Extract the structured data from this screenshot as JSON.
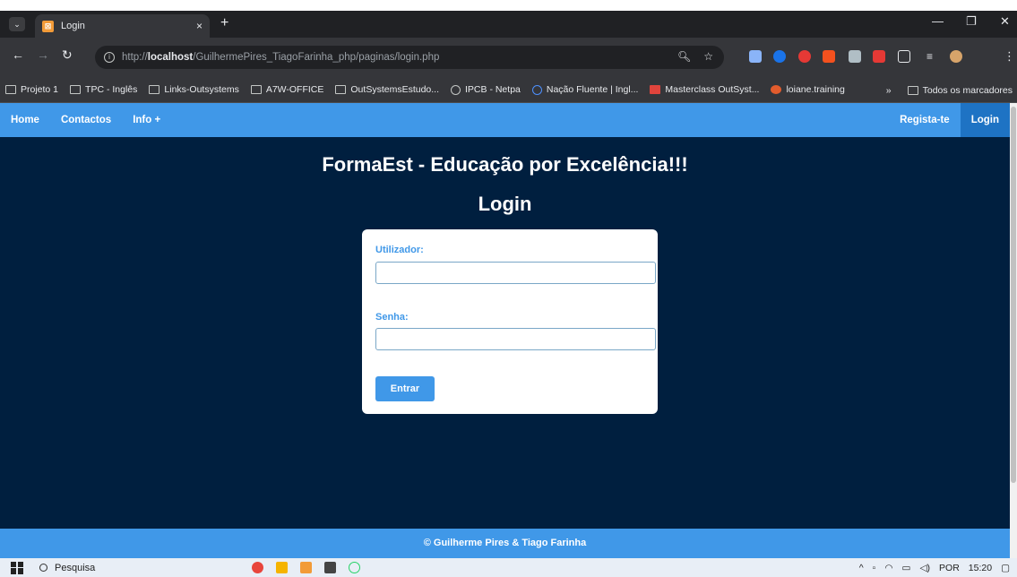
{
  "browser": {
    "tab_title": "Login",
    "tab_close": "×",
    "new_tab": "+",
    "url_prefix": "http://",
    "url_host": "localhost",
    "url_path": "/GuilhermePires_TiagoFarinha_php/paginas/login.php",
    "bookmarks": [
      "Projeto 1",
      "TPC - Inglês",
      "Links-Outsystems",
      "A7W-OFFICE",
      "OutSystemsEstudo...",
      "IPCB - Netpa",
      "Nação Fluente | Ingl...",
      "Masterclass OutSyst...",
      "loiane.training"
    ],
    "bookmarks_more": "»",
    "all_bookmarks": "Todos os marcadores"
  },
  "nav": {
    "home": "Home",
    "contactos": "Contactos",
    "info": "Info +",
    "registar": "Regista-te",
    "login": "Login"
  },
  "page": {
    "heading": "FormaEst - Educação por Excelência!!!",
    "subheading": "Login"
  },
  "form": {
    "user_label": "Utilizador:",
    "user_value": "",
    "password_label": "Senha:",
    "password_value": "",
    "submit": "Entrar"
  },
  "footer": {
    "text": "© Guilherme Pires & Tiago Farinha"
  },
  "taskbar": {
    "search": "Pesquisa",
    "language": "POR",
    "time": "15:20"
  },
  "colors": {
    "page_bg": "#001f3f",
    "accent": "#4098e8",
    "active_nav": "#1e73c4"
  }
}
